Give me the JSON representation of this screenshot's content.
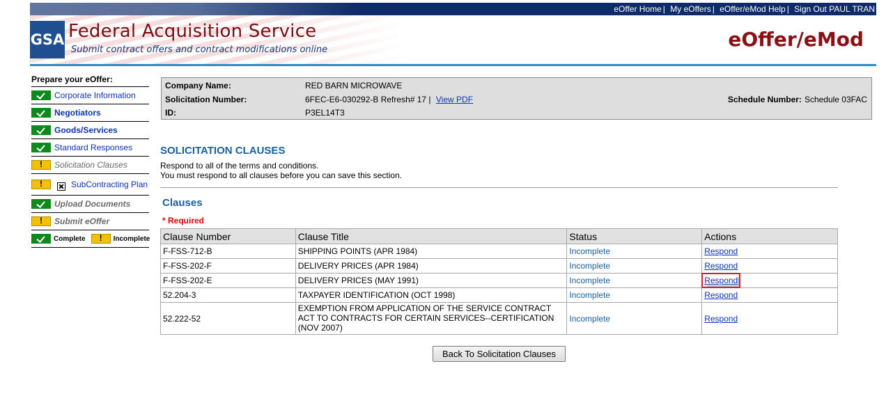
{
  "top_links": [
    {
      "label": "eOffer Home",
      "sep": "|"
    },
    {
      "label": "My eOffers",
      "sep": "|"
    },
    {
      "label": "eOffer/eMod Help",
      "sep": "|"
    },
    {
      "label": "Sign Out PAUL TRAN",
      "sep": ""
    }
  ],
  "header": {
    "logo_text": "GSA",
    "title": "Federal Acquisition Service",
    "subtitle": "Submit contract offers and contract modifications online",
    "brand": "eOffer/eMod"
  },
  "sidebar": {
    "title": "Prepare your eOffer:",
    "items": [
      {
        "label": "Corporate Information",
        "status": "complete"
      },
      {
        "label": "Negotiators",
        "status": "complete"
      },
      {
        "label": "Goods/Services",
        "status": "complete"
      },
      {
        "label": "Standard Responses",
        "status": "complete"
      },
      {
        "label": "Solicitation Clauses",
        "status": "incomplete"
      },
      {
        "label": "SubContracting Plan",
        "status": "incomplete"
      },
      {
        "label": "Upload Documents",
        "status": "complete"
      },
      {
        "label": "Submit eOffer",
        "status": "incomplete"
      }
    ],
    "legend": {
      "complete": "Complete",
      "incomplete": "Incomplete"
    }
  },
  "info": {
    "company_label": "Company Name:",
    "company_value": "RED BARN MICROWAVE",
    "solicitation_label": "Solicitation Number:",
    "solicitation_value": "6FEC-E6-030292-B Refresh# 17 |",
    "view_pdf": "View PDF",
    "id_label": "ID:",
    "id_value": "P3EL14T3",
    "schedule_label": "Schedule Number:",
    "schedule_value": "Schedule 03FAC"
  },
  "main": {
    "section_title": "SOLICITATION CLAUSES",
    "instruction_1": "Respond to all of the terms and conditions.",
    "instruction_2": "You must respond to all clauses before you can save this section.",
    "clauses_title": "Clauses",
    "required_note": "* Required",
    "back_button": "Back To Solicitation Clauses"
  },
  "table": {
    "headers": [
      "Clause Number",
      "Clause Title",
      "Status",
      "Actions"
    ],
    "rows": [
      {
        "number": "F-FSS-712-B",
        "title": "SHIPPING POINTS (APR 1984)",
        "status": "Incomplete",
        "action": "Respond"
      },
      {
        "number": "F-FSS-202-F",
        "title": "DELIVERY PRICES (APR 1984)",
        "status": "Incomplete",
        "action": "Respond"
      },
      {
        "number": "F-FSS-202-E",
        "title": "DELIVERY PRICES (MAY 1991)",
        "status": "Incomplete",
        "action": "Respond"
      },
      {
        "number": "52.204-3",
        "title": "TAXPAYER IDENTIFICATION (OCT 1998)",
        "status": "Incomplete",
        "action": "Respond"
      },
      {
        "number": "52.222-52",
        "title": "EXEMPTION FROM APPLICATION OF THE SERVICE CONTRACT ACT TO CONTRACTS FOR CERTAIN SERVICES--CERTIFICATION (NOV 2007)",
        "status": "Incomplete",
        "action": "Respond"
      }
    ]
  },
  "colors": {
    "header_bar": "#0e2c6a",
    "accent_rule": "#2e8ac6",
    "brand": "#8a1016",
    "section_title": "#1a5f9e",
    "required": "#e00000",
    "complete_icon": "#0d8a1b",
    "incomplete_icon": "#f2c200",
    "highlight": "#c8262c"
  }
}
